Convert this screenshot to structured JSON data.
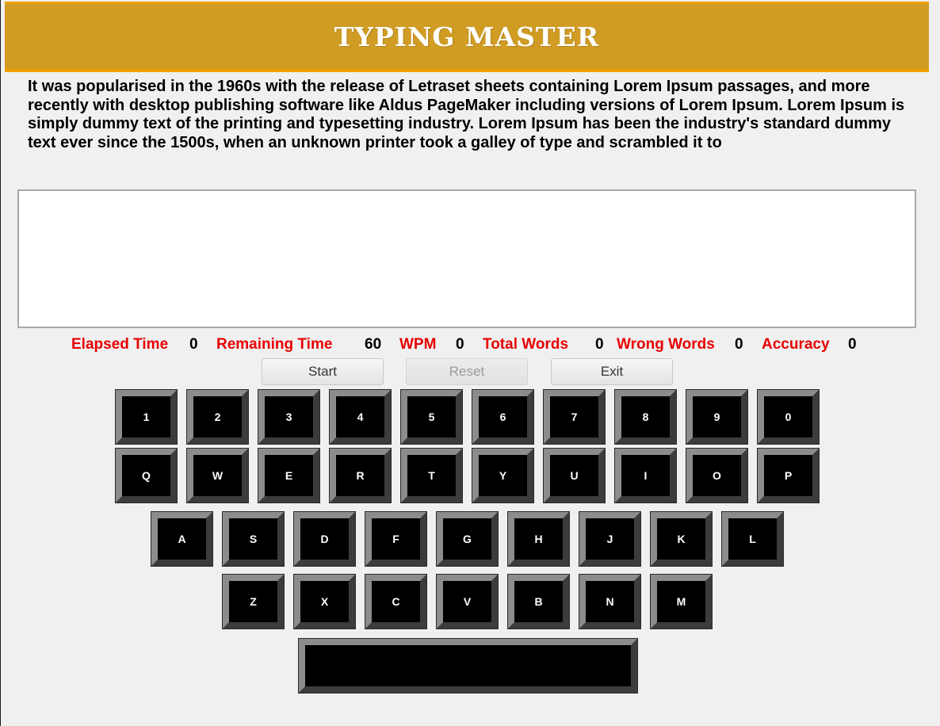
{
  "header": {
    "title": "TYPING MASTER"
  },
  "passage": "It was popularised in the 1960s with the release of Letraset sheets containing Lorem Ipsum passages, and more recently with desktop publishing software like Aldus PageMaker including versions of Lorem Ipsum. Lorem Ipsum is simply dummy text of the printing and typesetting industry. Lorem Ipsum has been the industry's standard dummy text ever since the 1500s, when an unknown printer took a galley of type and scrambled it to",
  "typing_area": {
    "value": ""
  },
  "stats": {
    "elapsed_label": "Elapsed Time",
    "elapsed_value": "0",
    "remaining_label": "Remaining Time",
    "remaining_value": "60",
    "wpm_label": "WPM",
    "wpm_value": "0",
    "total_label": "Total Words",
    "total_value": "0",
    "wrong_label": "Wrong Words",
    "wrong_value": "0",
    "accuracy_label": "Accuracy",
    "accuracy_value": "0"
  },
  "buttons": {
    "start": "Start",
    "reset": "Reset",
    "exit": "Exit"
  },
  "keyboard": {
    "row1": [
      "1",
      "2",
      "3",
      "4",
      "5",
      "6",
      "7",
      "8",
      "9",
      "0"
    ],
    "row2": [
      "Q",
      "W",
      "E",
      "R",
      "T",
      "Y",
      "U",
      "I",
      "O",
      "P"
    ],
    "row3": [
      "A",
      "S",
      "D",
      "F",
      "G",
      "H",
      "J",
      "K",
      "L"
    ],
    "row4": [
      "Z",
      "X",
      "C",
      "V",
      "B",
      "N",
      "M"
    ]
  },
  "colors": {
    "header_bg": "#d09c24",
    "header_border": "#f0a000",
    "stat_label": "#e80000",
    "key_face": "#000000"
  }
}
